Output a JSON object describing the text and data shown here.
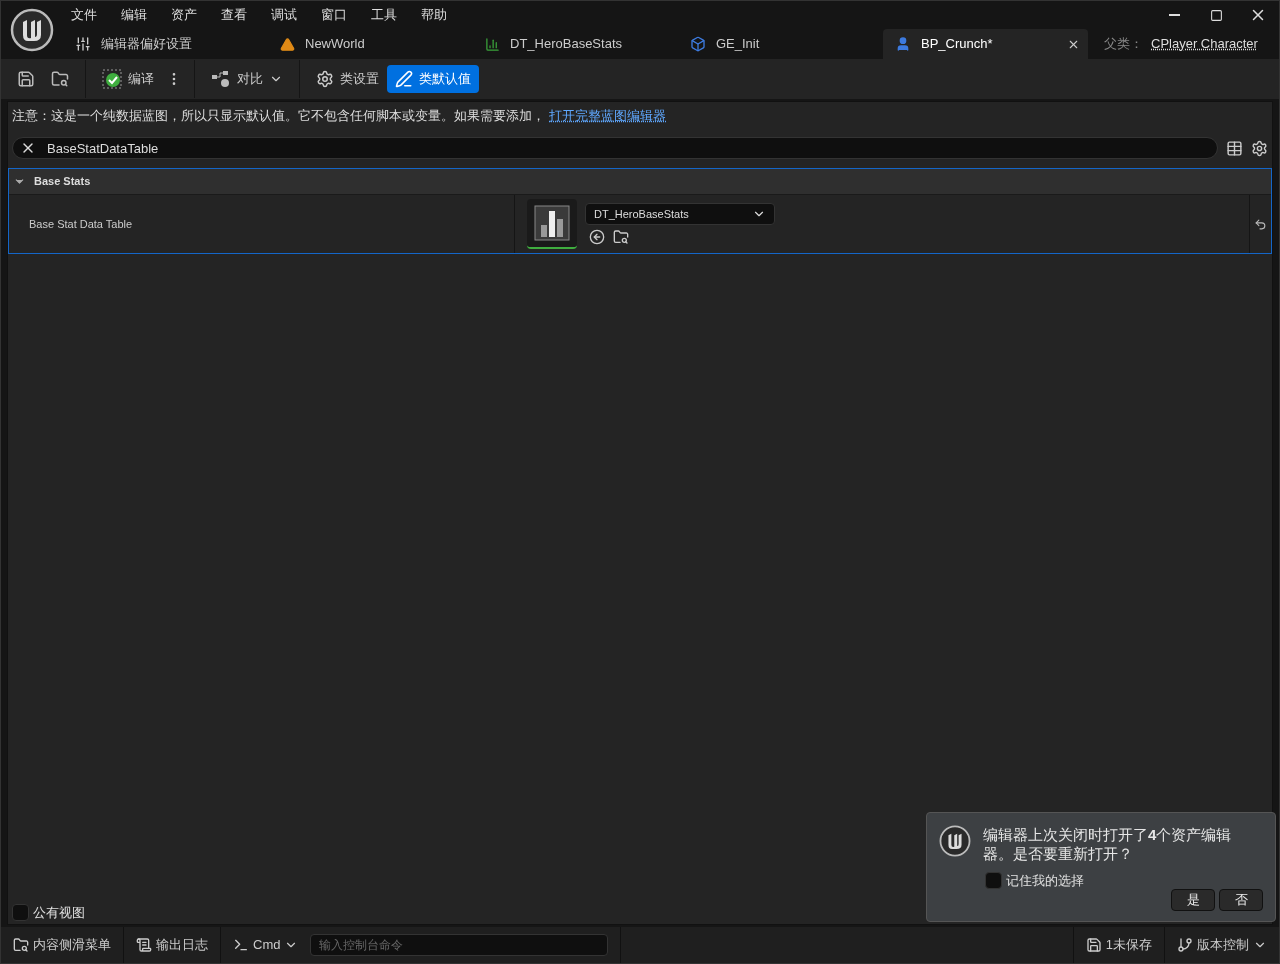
{
  "menu": [
    "文件",
    "编辑",
    "资产",
    "查看",
    "调试",
    "窗口",
    "工具",
    "帮助"
  ],
  "tabs": [
    {
      "label": "编辑器偏好设置",
      "kind": "settings",
      "selected": false
    },
    {
      "label": "NewWorld",
      "kind": "level",
      "selected": false
    },
    {
      "label": "DT_HeroBaseStats",
      "kind": "datatable",
      "selected": false
    },
    {
      "label": "GE_Init",
      "kind": "effect",
      "selected": false
    },
    {
      "label": "BP_Crunch*",
      "kind": "blueprint",
      "selected": true
    }
  ],
  "parent_class": {
    "label": "父类：",
    "value": "CPlayer Character"
  },
  "toolbar": [
    {
      "kind": "save"
    },
    {
      "kind": "browse"
    },
    {
      "kind": "compile",
      "label": "编译"
    },
    {
      "kind": "more"
    },
    {
      "kind": "diff",
      "label": "对比"
    },
    {
      "kind": "class_settings",
      "label": "类设置",
      "selected": false
    },
    {
      "kind": "class_defaults",
      "label": "类默认值",
      "selected": true
    }
  ],
  "notice": {
    "text": "注意：这是一个纯数据蓝图，所以只显示默认值。它不包含任何脚本或变量。如果需要添加，",
    "link": "打开完整蓝图编辑器"
  },
  "search": {
    "value": "BaseStatDataTable"
  },
  "category": {
    "title": "Base Stats",
    "expanded": true,
    "properties": [
      {
        "name": "Base Stat Data Table",
        "value": "DT_HeroBaseStats"
      }
    ]
  },
  "public_view": {
    "label": "公有视图",
    "checked": false
  },
  "toast": {
    "message": "编辑器上次关闭时打开了**4**个资产编辑器。是否要重新打开？",
    "remember": {
      "label": "记住我的选择",
      "checked": false
    },
    "buttons": [
      "是",
      "否"
    ]
  },
  "status_bar": {
    "content_drawer": "内容侧滑菜单",
    "output_log": "输出日志",
    "cmd": "Cmd",
    "console_placeholder": "输入控制台命令",
    "unsaved": "1未保存",
    "source_control": "版本控制"
  }
}
